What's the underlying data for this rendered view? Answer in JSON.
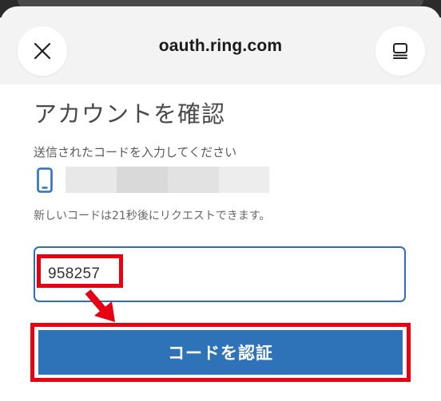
{
  "browser": {
    "site_title": "oauth.ring.com",
    "close_icon": "close-icon",
    "menu_icon": "tabs-menu-icon"
  },
  "verify": {
    "heading": "アカウントを確認",
    "instruction": "送信されたコードを入力してください",
    "device_icon": "smartphone-icon",
    "resend_note": "新しいコードは21秒後にリクエストできます。",
    "code_value": "958257",
    "submit_label": "コードを認証"
  },
  "colors": {
    "accent_blue": "#2e72b8",
    "annotation_red": "#e60012",
    "input_border": "#2f6fb5"
  }
}
